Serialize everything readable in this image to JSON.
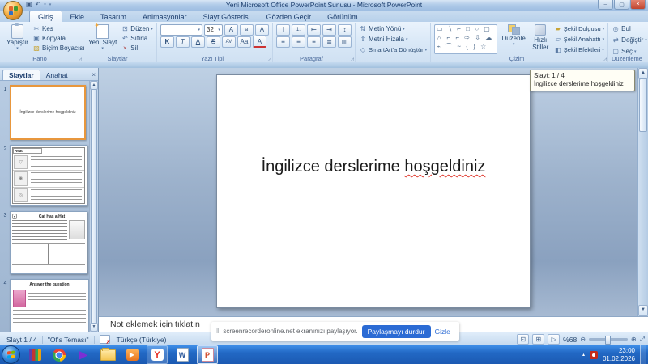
{
  "window": {
    "title": "Yeni Microsoft Office PowerPoint Sunusu - Microsoft PowerPoint"
  },
  "icons": {
    "save": "▣",
    "undo": "↶",
    "arrow_down": "▾",
    "minimize": "–",
    "maximize": "▢",
    "close": "×",
    "cut": "✂",
    "copy": "▣",
    "painter": "▨",
    "grow_font": "A",
    "shrink_font": "a",
    "clear_format": "A",
    "bullets": "⁝",
    "numbering": "1.",
    "indent_decrease": "⇤",
    "indent_increase": "⇥",
    "line_spacing": "↕",
    "columns": "▥",
    "align_left": "≡",
    "align_center": "≡",
    "align_right": "≡",
    "justify": "≣",
    "text_direction": "⇅",
    "align_text": "⇕",
    "smartart": "◇",
    "shape_fill": "▰",
    "shape_outline": "▱",
    "shape_effects": "◧",
    "find": "◎",
    "replace": "⇄",
    "select": "▢",
    "scroll_up": "▲",
    "scroll_down": "▼",
    "view_normal": "⊡",
    "view_sorter": "⊞",
    "view_show": "▷",
    "zoom_out": "⊖",
    "zoom_in": "⊕",
    "fit": "⤢",
    "tray_up": "▴",
    "pause": "‖",
    "play": "▶",
    "dialog_launcher": "◿",
    "panel_close": "×",
    "new_slide_star": "✦",
    "thumb_img_hoop": "▽",
    "thumb_img_owl": "◉",
    "thumb_img_octopus": "◎",
    "yandex_letter": "Y",
    "word_letter": "W",
    "ppt_letter": "P"
  },
  "ribbon": {
    "tabs": [
      {
        "label": "Giriş"
      },
      {
        "label": "Ekle"
      },
      {
        "label": "Tasarım"
      },
      {
        "label": "Animasyonlar"
      },
      {
        "label": "Slayt Gösterisi"
      },
      {
        "label": "Gözden Geçir"
      },
      {
        "label": "Görünüm"
      }
    ],
    "pano": {
      "label": "Pano",
      "paste": "Yapıştır",
      "cut": "Kes",
      "copy": "Kopyala",
      "painter": "Biçim Boyacısı"
    },
    "slides_group": {
      "label": "Slaytlar",
      "new_slide": "Yeni Slayt",
      "layout": "Düzen",
      "reset": "Sıfırla",
      "del": "Sil"
    },
    "font_group": {
      "label": "Yazı Tipi",
      "font_name": "",
      "size": "32",
      "bold": "K",
      "italic": "T",
      "underline": "A",
      "strike": "S",
      "spacing": "AV",
      "case": "Aa",
      "color": "A"
    },
    "paragraph_group": {
      "label": "Paragraf"
    },
    "text_group": {
      "direction": "Metin Yönü",
      "align": "Metni Hizala",
      "smartart": "SmartArt'a Dönüştür"
    },
    "drawing_group": {
      "label": "Çizim",
      "arrange": "Düzenle",
      "quick_styles": "Hızlı Stiller",
      "fill": "Şekil Dolgusu",
      "outline": "Şekil Anahattı",
      "effects": "Şekil Efektleri",
      "shapes_row1": "▭ ∖ ⌐ □ ○ ▢",
      "shapes_row2": "△ ⌐ ⌐ ⇨ ⇩ ☁",
      "shapes_row3": "⌁ ⌒ ~ { } ☆"
    },
    "editing_group": {
      "label": "Düzenleme",
      "find": "Bul",
      "replace": "Değiştir",
      "select": "Seç"
    }
  },
  "panel": {
    "tab_slides": "Slaytlar",
    "tab_outline": "Anahat",
    "slides": [
      {
        "num": "1",
        "text": "İngilizce derslerime hoşgeldiniz"
      },
      {
        "num": "2",
        "title": "Read"
      },
      {
        "num": "3",
        "title": "Cat Has a Hat"
      },
      {
        "num": "4",
        "title": "Answer the question"
      }
    ]
  },
  "slide": {
    "title_part1": "İngilizce derslerime ",
    "title_part2": "hoşgeldiniz"
  },
  "tooltip": {
    "line1": "Slayt: 1 / 4",
    "line2": "İngilizce derslerime hoşgeldiniz"
  },
  "notes": {
    "placeholder": "Not eklemek için tıklatın"
  },
  "recorder": {
    "text": "screenrecorderonline.net ekranınızı paylaşıyor.",
    "stop": "Paylaşmayı durdur",
    "hide": "Gizle"
  },
  "statusbar": {
    "slide": "Slayt 1 / 4",
    "theme": "\"Ofis Teması\"",
    "language": "Türkçe (Türkiye)",
    "zoom": "%68"
  },
  "taskbar": {
    "time": "23:00",
    "date": "01.02.2026"
  },
  "colors": {
    "accent_blue": "#2b6bd4",
    "selection_orange": "#e8973d",
    "title_red_underline": "#e03a2f"
  }
}
